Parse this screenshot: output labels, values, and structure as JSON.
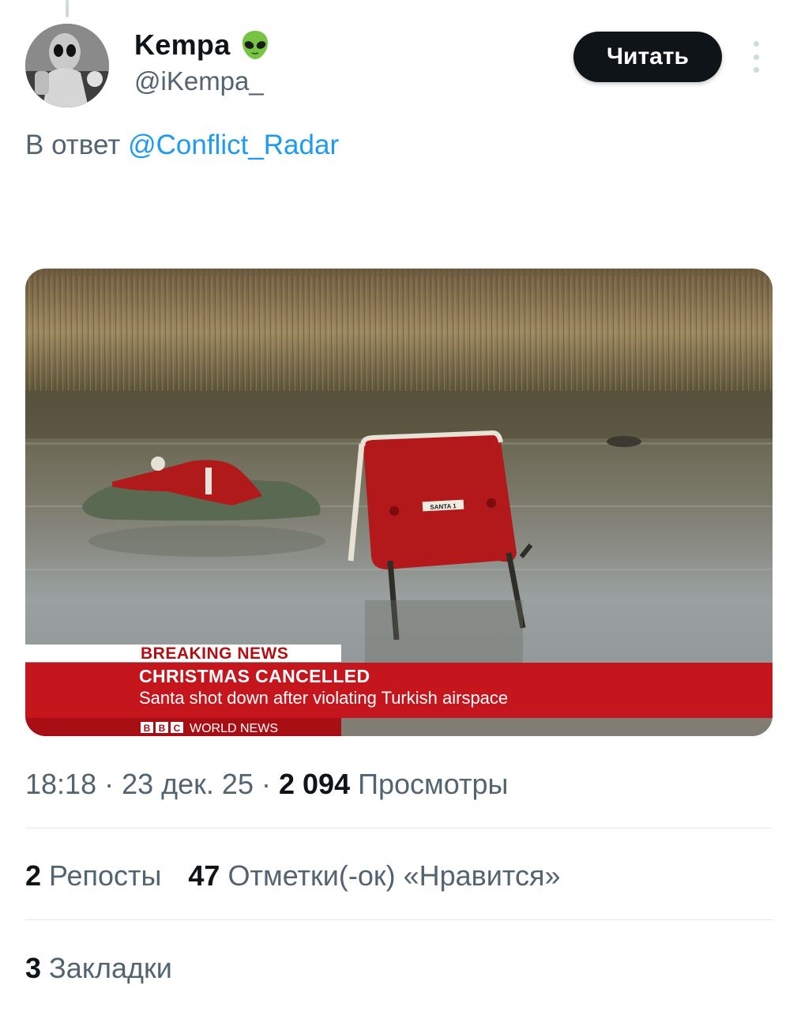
{
  "tweet": {
    "author_name": "Kempa",
    "author_handle": "@iKempa_",
    "follow_label": "Читать",
    "reply_prefix": "В ответ",
    "reply_mention": "@Conflict_Radar",
    "time": "18:18",
    "date": "23 дек. 25",
    "views_count": "2 094",
    "views_label": "Просмотры",
    "reposts_count": "2",
    "reposts_label": "Репосты",
    "likes_count": "47",
    "likes_label": "Отметки(-ок) «Нравится»",
    "bookmarks_count": "3",
    "bookmarks_label": "Закладки"
  },
  "media": {
    "breaking_label": "BREAKING NEWS",
    "headline": "CHRISTMAS CANCELLED",
    "subline": "Santa shot down after violating Turkish airspace",
    "channel": "WORLD NEWS",
    "sleigh_plate": "SANTA 1",
    "brand_letters": [
      "B",
      "B",
      "C"
    ]
  },
  "colors": {
    "accent": "#1d9bf0",
    "text_primary": "#0f1419",
    "text_secondary": "#536471",
    "bbc_red": "#c4161c"
  },
  "icons": [
    "alien-emoji-icon",
    "more-options-icon"
  ]
}
